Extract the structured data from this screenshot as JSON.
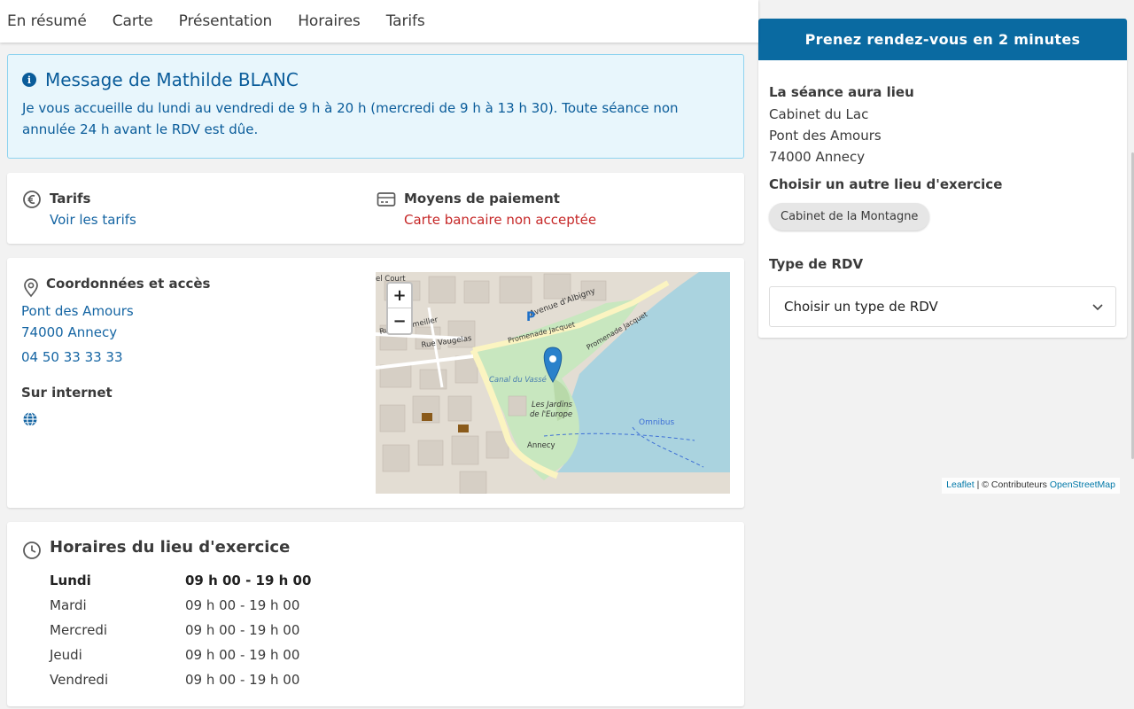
{
  "nav": {
    "items": [
      {
        "label": "En résumé"
      },
      {
        "label": "Carte"
      },
      {
        "label": "Présentation"
      },
      {
        "label": "Horaires"
      },
      {
        "label": "Tarifs"
      }
    ]
  },
  "message": {
    "icon": "info-icon",
    "title": "Message de Mathilde BLANC",
    "text": "Je vous accueille du lundi au vendredi de 9 h à 20 h (mercredi de 9 h à 13 h 30). Toute séance non annulée 24 h avant le RDV est dûe."
  },
  "payment": {
    "tarifs_label": "Tarifs",
    "tarifs_link": "Voir les tarifs",
    "tarifs_icon": "euro-icon",
    "moyens_label": "Moyens de paiement",
    "moyens_value": "Carte bancaire non acceptée",
    "moyens_icon": "credit-card-icon",
    "warning_color": "#c62828"
  },
  "contact": {
    "title": "Coordonnées et accès",
    "address_line1": "Pont des Amours",
    "address_line2": "74000 Annecy",
    "phone": "04 50 33 33 33",
    "internet_label": "Sur internet",
    "internet_icon": "globe-icon"
  },
  "map": {
    "zoom_in": "+",
    "zoom_out": "−",
    "attribution_leaflet": "Leaflet",
    "attribution_sep": " | © Contributeurs ",
    "attribution_osm": "OpenStreetMap",
    "labels": {
      "avenue": "Avenue d'Albigny",
      "promenade1": "Promenade Jacquet",
      "promenade2": "Promenade Jacquet",
      "canal": "Canal du Vassé",
      "jardins1": "Les Jardins",
      "jardins2": "de l'Europe",
      "annecy": "Annecy",
      "omnibus": "Omnibus",
      "ruevaugelas": "Rue Vaugelas",
      "rue2": "Rue Sommeiller",
      "parking": "P",
      "court": "el Court"
    }
  },
  "hours": {
    "title": "Horaires du lieu d'exercice",
    "rows": [
      {
        "day": "Lundi",
        "time": "09 h 00 - 19 h 00"
      },
      {
        "day": "Mardi",
        "time": "09 h 00 - 19 h 00"
      },
      {
        "day": "Mercredi",
        "time": "09 h 00 - 19 h 00"
      },
      {
        "day": "Jeudi",
        "time": "09 h 00 - 19 h 00"
      },
      {
        "day": "Vendredi",
        "time": "09 h 00 - 19 h 00"
      }
    ]
  },
  "booking": {
    "header": "Prenez rendez-vous en 2 minutes",
    "lieu_label": "La séance aura lieu",
    "lieu_name": "Cabinet du Lac",
    "lieu_line1": "Pont des Amours",
    "lieu_line2": "74000 Annecy",
    "other_label": "Choisir un autre lieu d'exercice",
    "other_chip": "Cabinet de la Montagne",
    "type_label": "Type de RDV",
    "type_select": "Choisir un type de RDV"
  },
  "colors": {
    "primary": "#0a6aa1",
    "link": "#1565a3",
    "info_bg": "#e8f6fc"
  }
}
